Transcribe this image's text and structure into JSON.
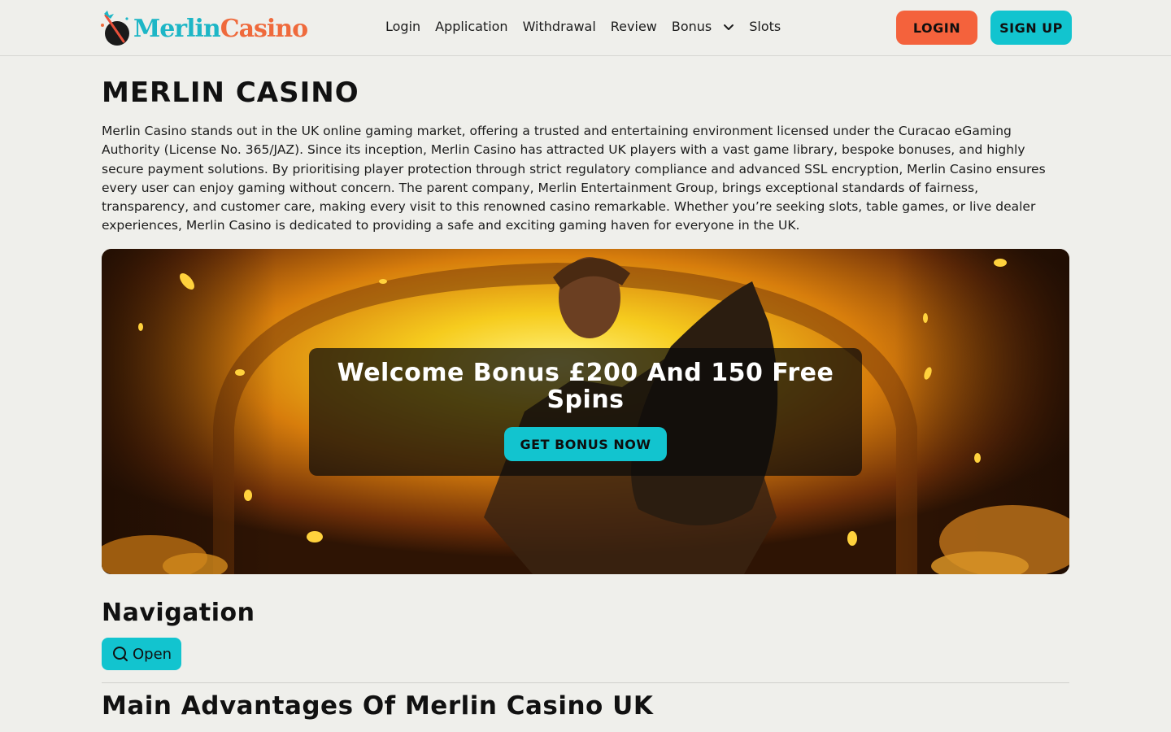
{
  "header": {
    "logo": {
      "text_a": "Merlin",
      "text_b": "Casino"
    },
    "nav": [
      {
        "label": "Login"
      },
      {
        "label": "Application"
      },
      {
        "label": "Withdrawal"
      },
      {
        "label": "Review"
      },
      {
        "label": "Bonus"
      },
      {
        "label": "Slots"
      }
    ],
    "login_label": "LOGIN",
    "signup_label": "SIGN UP"
  },
  "main": {
    "title": "MERLIN CASINO",
    "intro": "Merlin Casino stands out in the UK online gaming market, offering a trusted and entertaining environment licensed under the Curacao eGaming Authority (License No. 365/JAZ). Since its inception, Merlin Casino has attracted UK players with a vast game library, bespoke bonuses, and highly secure payment solutions. By prioritising player protection through strict regulatory compliance and advanced SSL encryption, Merlin Casino ensures every user can enjoy gaming without concern. The parent company, Merlin Entertainment Group, brings exceptional standards of fairness, transparency, and customer care, making every visit to this renowned casino remarkable. Whether you’re seeking slots, table games, or live dealer experiences, Merlin Casino is dedicated to providing a safe and exciting gaming haven for everyone in the UK.",
    "hero": {
      "title": "Welcome Bonus £200 And 150 Free Spins",
      "button": "GET BONUS NOW"
    },
    "navigation_heading": "Navigation",
    "open_label": "Open",
    "advantages_heading": "Main Advantages Of Merlin Casino UK"
  },
  "colors": {
    "accent_teal": "#12c4cf",
    "accent_orange": "#f4623c",
    "background": "#efefeb"
  }
}
